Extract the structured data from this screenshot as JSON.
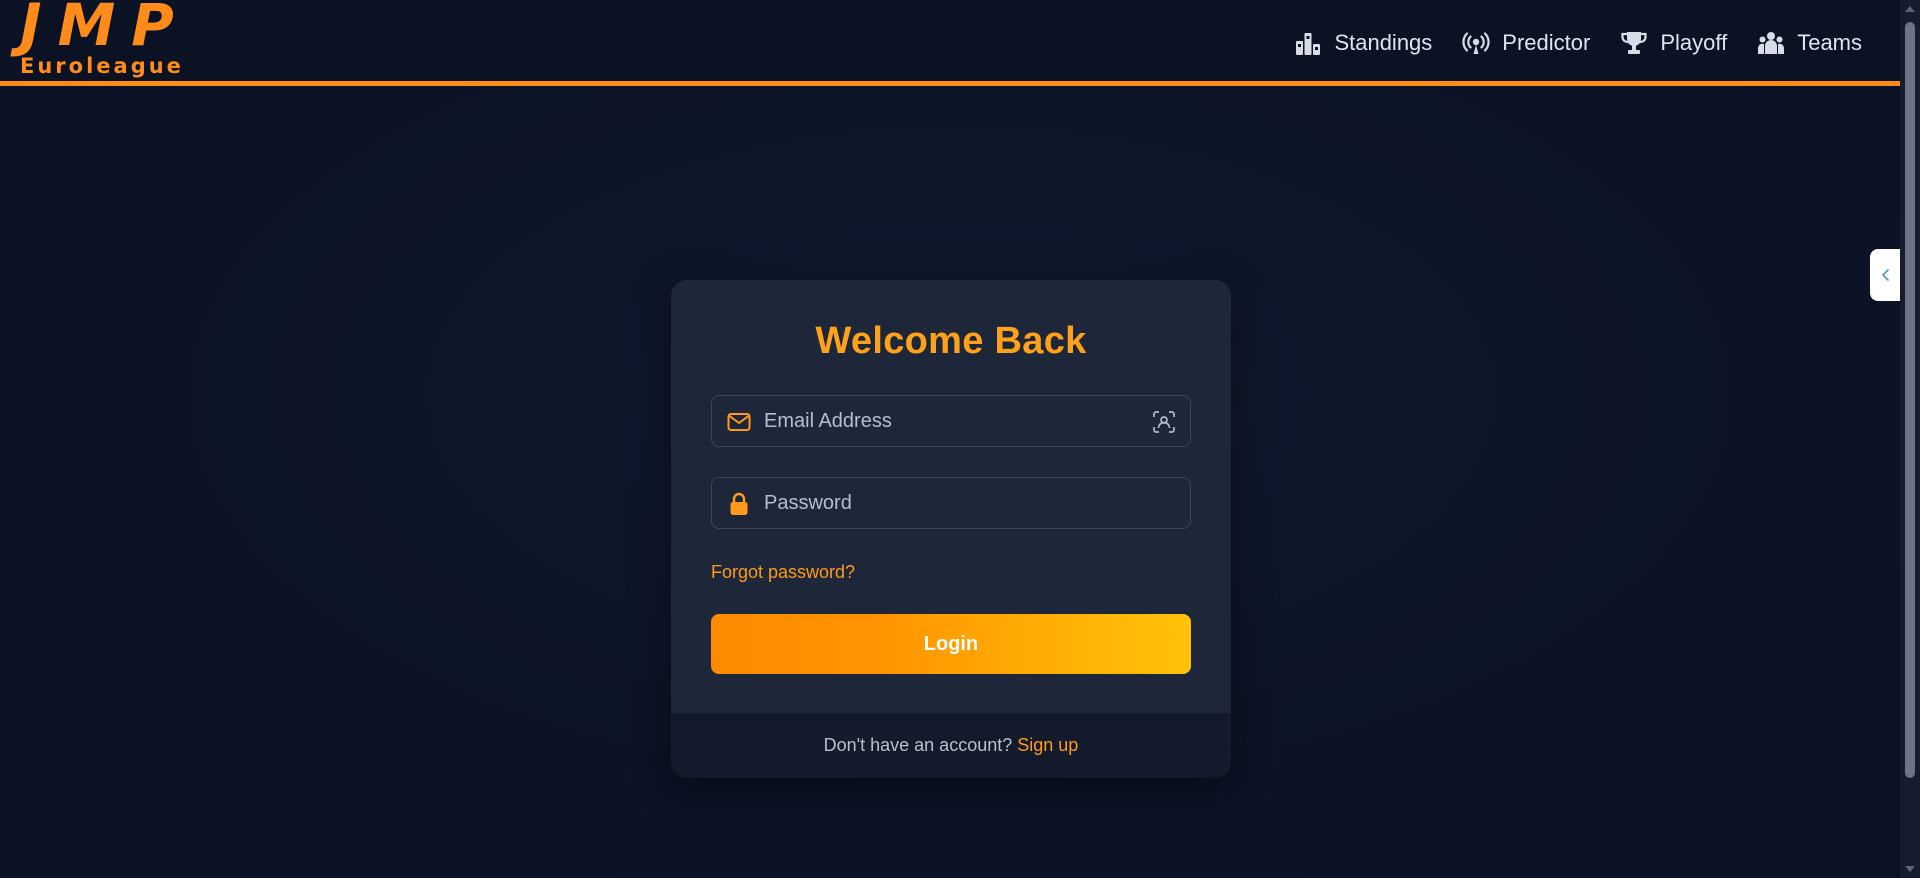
{
  "logo": {
    "main": "JMP",
    "sub": "Euroleague"
  },
  "nav": {
    "items": [
      {
        "label": "Standings",
        "icon": "standings-icon"
      },
      {
        "label": "Predictor",
        "icon": "broadcast-icon"
      },
      {
        "label": "Playoff",
        "icon": "trophy-icon"
      },
      {
        "label": "Teams",
        "icon": "users-icon"
      }
    ]
  },
  "login": {
    "title": "Welcome Back",
    "email_placeholder": "Email Address",
    "email_value": "",
    "password_placeholder": "Password",
    "password_value": "",
    "forgot_label": "Forgot password?",
    "login_label": "Login",
    "footer_text": "Don't have an account?",
    "signup_label": "Sign up"
  },
  "colors": {
    "accent": "#ff8c1a",
    "title": "#ffa21a",
    "background": "#0c1326",
    "card": "#1d2739",
    "card_footer": "#121a2b"
  }
}
